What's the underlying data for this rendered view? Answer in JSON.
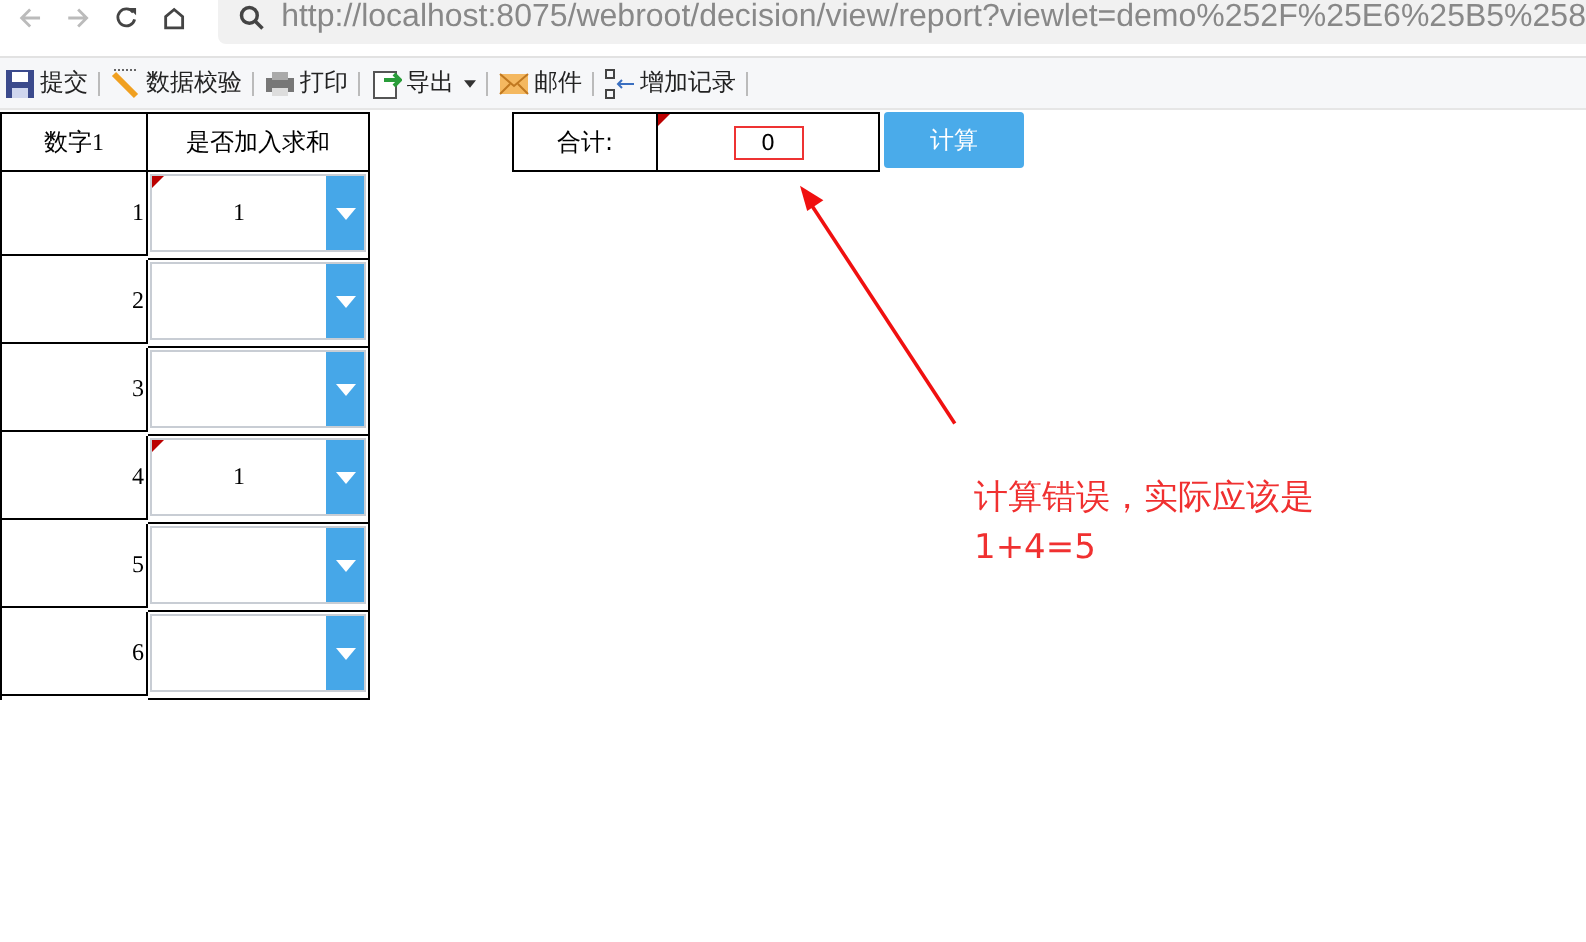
{
  "browser": {
    "url": "http://localhost:8075/webroot/decision/view/report?viewlet=demo%252F%25E6%25B5%258"
  },
  "toolbar": [
    {
      "kind": "save",
      "label": "提交"
    },
    {
      "kind": "check",
      "label": "数据校验"
    },
    {
      "kind": "print",
      "label": "打印"
    },
    {
      "kind": "export",
      "label": "导出"
    },
    {
      "kind": "mail",
      "label": "邮件"
    },
    {
      "kind": "add",
      "label": "增加记录"
    }
  ],
  "table": {
    "columns": [
      "数字1",
      "是否加入求和"
    ],
    "rows": [
      {
        "number": "1",
        "value": "1",
        "edited": true
      },
      {
        "number": "2",
        "value": "",
        "edited": false
      },
      {
        "number": "3",
        "value": "",
        "edited": false
      },
      {
        "number": "4",
        "value": "1",
        "edited": true
      },
      {
        "number": "5",
        "value": "",
        "edited": false
      },
      {
        "number": "6",
        "value": "",
        "edited": false
      }
    ]
  },
  "sum": {
    "label": "合计:",
    "value": "0",
    "edited": true
  },
  "calc_button": "计算",
  "annotation": {
    "text": "计算错误，实际应该是\n1+4=5"
  }
}
